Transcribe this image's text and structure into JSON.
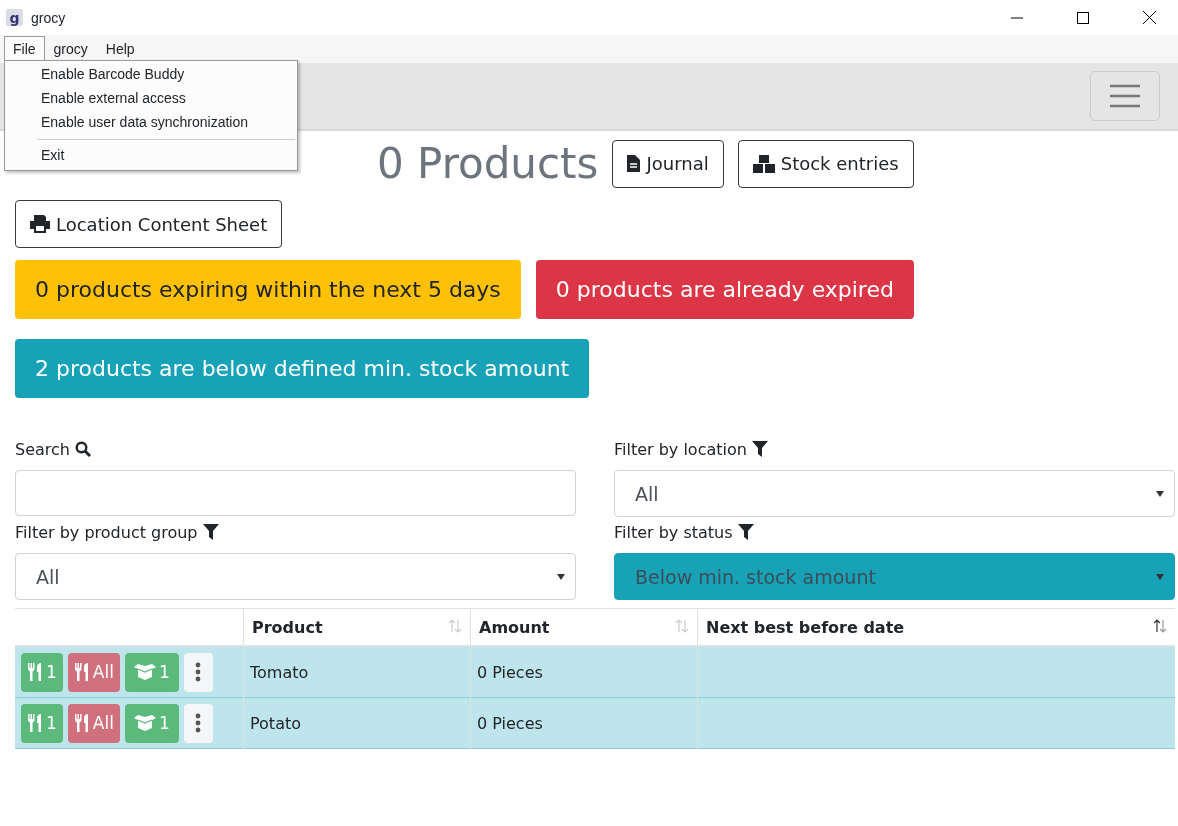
{
  "window": {
    "title": "grocy",
    "app_icon": "g"
  },
  "menu_bar": [
    {
      "label": "File",
      "selected": true
    },
    {
      "label": "grocy",
      "selected": false
    },
    {
      "label": "Help",
      "selected": false
    }
  ],
  "file_menu": [
    {
      "label": "Enable Barcode Buddy",
      "kind": "item"
    },
    {
      "label": "Enable external access",
      "kind": "item"
    },
    {
      "label": "Enable user data synchronization",
      "kind": "item"
    },
    {
      "kind": "separator"
    },
    {
      "label": "Exit",
      "kind": "item"
    }
  ],
  "page": {
    "count": "0 Products",
    "buttons": [
      {
        "label": "Journal",
        "kind": "journal"
      },
      {
        "label": "Stock entries",
        "kind": "entries"
      }
    ],
    "sheet_button": "Location Content Sheet"
  },
  "alerts": [
    {
      "text": "0 products expiring within the next 5 days",
      "kind": "warning"
    },
    {
      "text": "0 products are already expired",
      "kind": "danger"
    },
    {
      "text": "2 products are below defined min. stock amount",
      "kind": "info"
    }
  ],
  "filters": [
    {
      "label": "Search",
      "kind": "search"
    },
    {
      "label": "Filter by location",
      "kind": "select",
      "value": "All",
      "selected": false
    },
    {
      "label": "Filter by product group",
      "kind": "select",
      "value": "All",
      "selected": false
    },
    {
      "label": "Filter by status",
      "kind": "select",
      "value": "Below min. stock amount",
      "selected": true
    }
  ],
  "table": {
    "columns": [
      {
        "label": "Product",
        "sorted": false
      },
      {
        "label": "Amount",
        "sorted": false
      },
      {
        "label": "Next best before date",
        "sorted": true
      }
    ],
    "rows": [
      {
        "actions": [
          {
            "label": "1",
            "kind": "consume"
          },
          {
            "label": "All",
            "kind": "consume_all"
          },
          {
            "label": "1",
            "kind": "open"
          }
        ],
        "product": "Tomato",
        "amount": "0 Pieces",
        "highlighted": true
      },
      {
        "actions": [
          {
            "label": "1",
            "kind": "consume"
          },
          {
            "label": "All",
            "kind": "consume_all"
          },
          {
            "label": "1",
            "kind": "open"
          }
        ],
        "product": "Potato",
        "amount": "0 Pieces",
        "highlighted": true
      }
    ]
  }
}
